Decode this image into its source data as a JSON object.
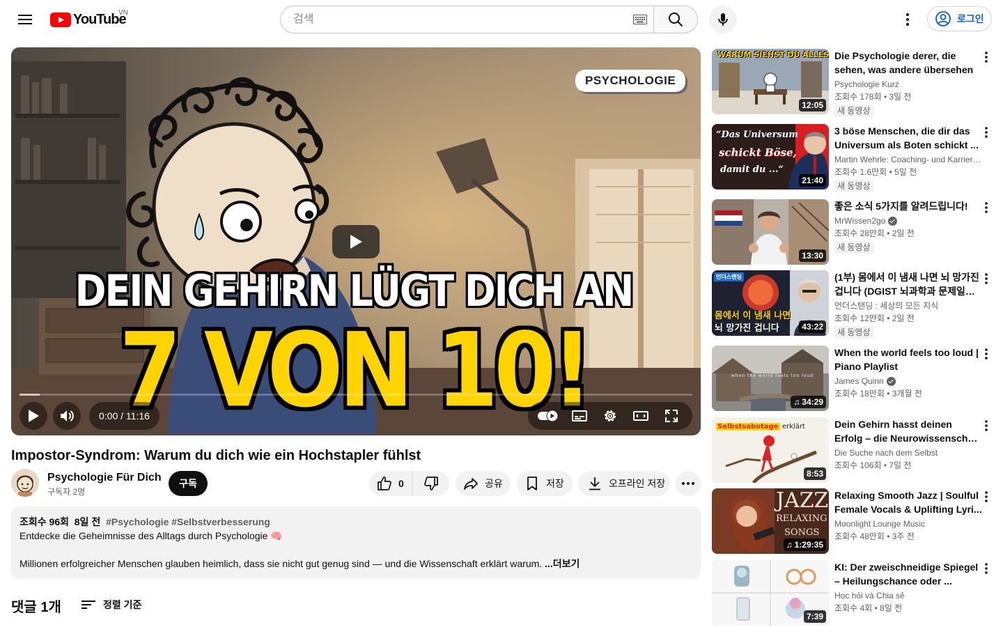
{
  "header": {
    "logo_text": "YouTube",
    "country_code": "VN",
    "search_placeholder": "검색",
    "signin_label": "로그인"
  },
  "player": {
    "thumbnail_badge": "PSYCHOLOGIE",
    "thumbnail_headline": "DEIN GEHIRN LÜGT DICH AN",
    "thumbnail_big_text": "7 VON 10!",
    "current_time": "0:00",
    "duration": "11:16",
    "time_display": "0:00 / 11:16",
    "progress_fraction": 0.0
  },
  "video": {
    "title": "Impostor-Syndrom: Warum du dich wie ein Hochstapler fühlst",
    "channel_name": "Psychologie Für Dich",
    "subscribers": "구독자 2명",
    "subscribe_label": "구독",
    "like_count": "0",
    "share_label": "공유",
    "save_label": "저장",
    "download_label": "오프라인 저장"
  },
  "description": {
    "views": "조회수 96회",
    "age": "8일 전",
    "tags": "#Psychologie #Selbstverbesserung",
    "line1": "Entdecke die Geheimnisse des Alltags durch Psychologie 🧠",
    "line2": "Millionen erfolgreicher Menschen glauben heimlich, dass sie nicht gut genug sind — und die Wissenschaft erklärt warum.",
    "more_label": "...더보기"
  },
  "comments": {
    "count_label": "댓글 1개",
    "sort_label": "정렬 기준"
  },
  "recommendations": [
    {
      "title": "Die Psychologie derer, die sehen, was andere übersehen",
      "channel": "Psychologie Kurz",
      "verified": false,
      "views": "조회수 178회 • 3일 전",
      "badge": "새 동영상",
      "duration": "12:05",
      "thumb_text": "WARUM SIEHST DU ALLES?",
      "music": false
    },
    {
      "title": "3 böse Menschen, die dir das Universum als Boten schickt ...",
      "channel": "Martin Wehrle: Coaching- und Karrieretip...",
      "verified": false,
      "views": "조회수 1.6만회 • 5일 전",
      "badge": "새 동영상",
      "duration": "21:40",
      "thumb_text": "\"Das Universum schickt Böse, damit du ...\"",
      "thumb_lines": [
        "“Das Universum",
        "schickt Böse,",
        "damit du ...“"
      ],
      "music": false
    },
    {
      "title": "좋은 소식 5가지를 알려드립니다!",
      "channel": "MrWissen2go",
      "verified": true,
      "views": "조회수 28만회 • 2일 전",
      "badge": "새 동영상",
      "duration": "13:30",
      "music": false
    },
    {
      "title": "(1부) 몸에서 이 냄새 나면 뇌 망가진 겁니다 (DGIST 뇌과학과 문제일 교...",
      "channel": "언더스탠딩 : 세상의 모든 지식",
      "verified": false,
      "views": "조회수 12만회 • 2일 전",
      "badge": "새 동영상",
      "duration": "43:22",
      "thumb_lines": [
        "몸에서 이 냄새 나면",
        "뇌 망가진 겁니다"
      ],
      "thumb_tag": "언더스탠딩",
      "music": false
    },
    {
      "title": "When the world feels too loud | Piano Playlist",
      "channel": "James Quinn",
      "verified": true,
      "views": "조회수 18만회 • 3개월 전",
      "badge": "",
      "duration": "34:29",
      "thumb_text": "when the world feels too loud",
      "music": true
    },
    {
      "title": "Dein Gehirn hasst deinen Erfolg – die Neurowissenschaft erklä...",
      "channel": "Die Suche nach dem Selbst",
      "verified": false,
      "views": "조회수 106회 • 7일 전",
      "badge": "",
      "duration": "8:53",
      "thumb_text": "Selbstsabotage erklärt",
      "thumb_lines": [
        "Selbstsabotage",
        "erklärt"
      ],
      "music": false
    },
    {
      "title": "Relaxing Smooth Jazz | Soulful Female Vocals & Uplifting Lyri...",
      "channel": "Moonlight Lounge Music",
      "verified": false,
      "views": "조회수 48만회 • 3주 전",
      "badge": "",
      "duration": "1:29:35",
      "thumb_lines": [
        "JAZZ",
        "RELAXING",
        "SONGS"
      ],
      "music": true
    },
    {
      "title": "KI: Der zweischneidige Spiegel – Heilungschance oder ...",
      "channel": "Học hỏi và Chia sẻ",
      "verified": false,
      "views": "조회수 4회 • 8일 전",
      "badge": "",
      "duration": "7:39",
      "music": false
    }
  ],
  "colors": {
    "brand_red": "#ff0000",
    "link_blue": "#065fd4",
    "thumb_yellow": "#ffd400",
    "chip_bg": "#f2f2f2"
  }
}
